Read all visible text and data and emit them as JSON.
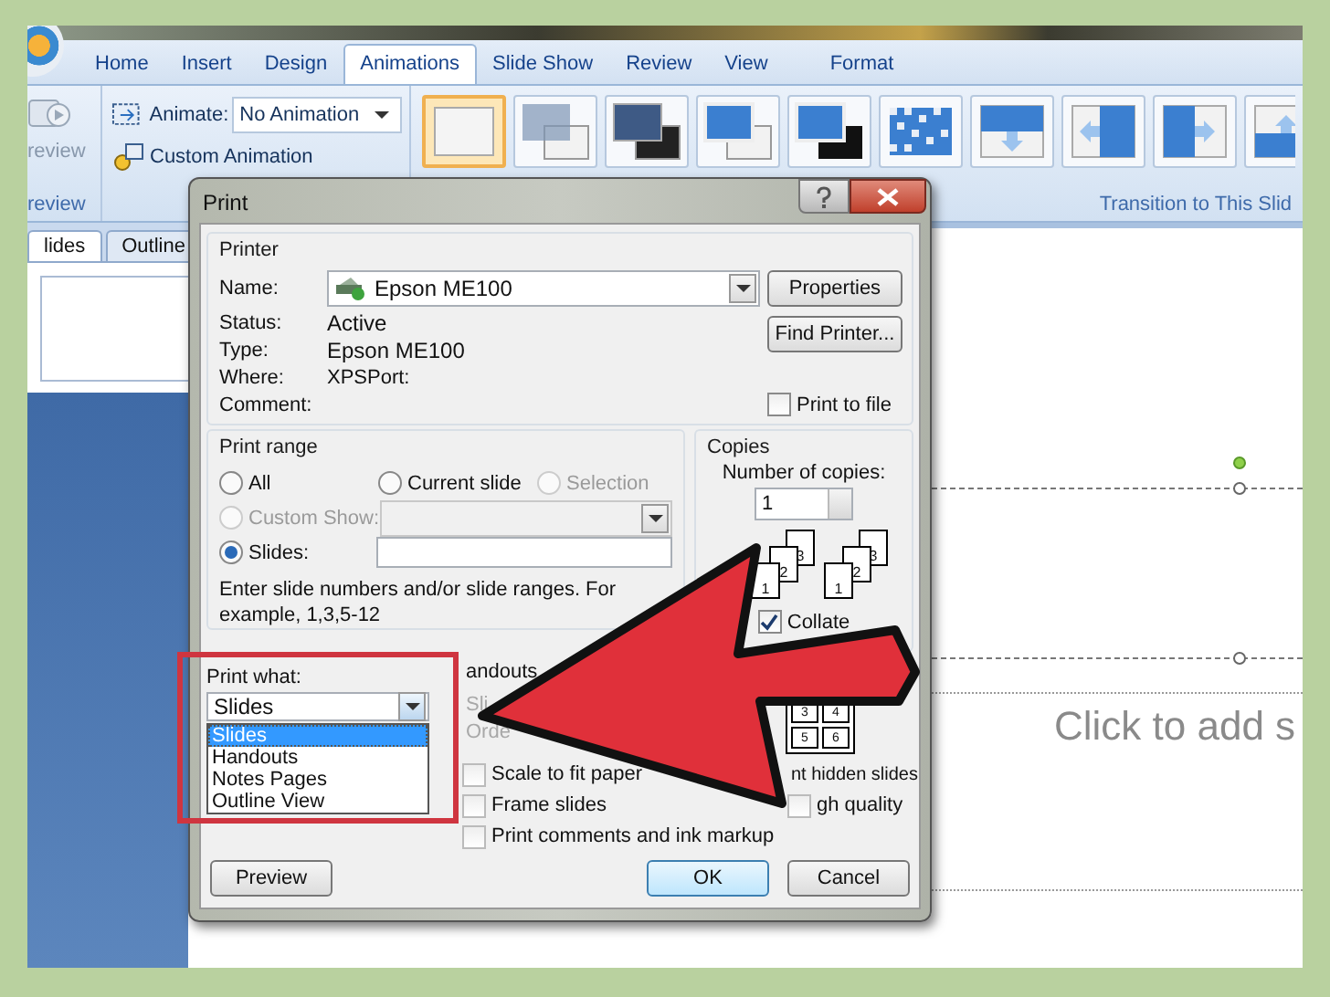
{
  "ribbon": {
    "tabs": [
      {
        "label": "Home",
        "selected": false
      },
      {
        "label": "Insert",
        "selected": false
      },
      {
        "label": "Design",
        "selected": false
      },
      {
        "label": "Animations",
        "selected": true
      },
      {
        "label": "Slide Show",
        "selected": false
      },
      {
        "label": "Review",
        "selected": false
      },
      {
        "label": "View",
        "selected": false
      },
      {
        "label": "Format",
        "selected": false
      }
    ],
    "preview_button": "review",
    "preview_group_label": "review",
    "animate_label": "Animate:",
    "animate_value": "No Animation",
    "custom_animation": "Custom Animation",
    "transitions": [
      {
        "kind": "plain",
        "selected": true
      },
      {
        "kind": "fade",
        "selected": false
      },
      {
        "kind": "fade-black",
        "selected": false
      },
      {
        "kind": "cut",
        "selected": false
      },
      {
        "kind": "cut-black",
        "selected": false
      },
      {
        "kind": "dissolve",
        "selected": false
      },
      {
        "kind": "cover-down",
        "selected": false
      },
      {
        "kind": "cover-left",
        "selected": false
      },
      {
        "kind": "cover-right",
        "selected": false
      },
      {
        "kind": "cover-up",
        "selected": false
      }
    ],
    "transition_group_label": "Transition to This Slid"
  },
  "pane_tabs": [
    {
      "label": "lides",
      "selected": true
    },
    {
      "label": "Outline",
      "selected": false
    }
  ],
  "slide": {
    "subtitle_placeholder": "Click to add s"
  },
  "dialog": {
    "title": "Print",
    "printer": {
      "heading": "Printer",
      "name_label": "Name:",
      "name": "Epson ME100",
      "status_label": "Status:",
      "status": "Active",
      "type_label": "Type:",
      "type": "Epson ME100",
      "where_label": "Where:",
      "where": "XPSPort:",
      "comment_label": "Comment:",
      "buttons": [
        "Properties",
        "Find Printer..."
      ],
      "print_to_file": {
        "label": "Print to file",
        "checked": false
      }
    },
    "print_range": {
      "heading": "Print range",
      "options": [
        {
          "label": "All",
          "selected": false,
          "disabled": false
        },
        {
          "label": "Current slide",
          "selected": false,
          "disabled": false
        },
        {
          "label": "Selection",
          "selected": false,
          "disabled": true
        },
        {
          "label": "Custom Show:",
          "selected": false,
          "disabled": true
        },
        {
          "label": "Slides:",
          "selected": true,
          "disabled": false
        }
      ],
      "hint": "Enter slide numbers and/or slide ranges. For example, 1,3,5-12"
    },
    "copies": {
      "heading": "Copies",
      "count_label": "Number of copies:",
      "count": "1",
      "page_numbers": [
        [
          "1",
          "2",
          "3"
        ],
        [
          "1",
          "2",
          "3"
        ]
      ],
      "collate": {
        "label": "Collate",
        "checked": true
      }
    },
    "print_what": {
      "label": "Print what:",
      "value": "Slides",
      "options": [
        {
          "label": "Slides",
          "selected": true
        },
        {
          "label": "Handouts",
          "selected": false
        },
        {
          "label": "Notes Pages",
          "selected": false
        },
        {
          "label": "Outline View",
          "selected": false
        }
      ]
    },
    "handouts": {
      "heading": "andouts",
      "labels": [
        "Sli",
        "Orde"
      ],
      "page_numbers": [
        "3",
        "4",
        "5",
        "6"
      ]
    },
    "options": [
      {
        "label": "Scale to fit paper",
        "checked": false
      },
      {
        "label": "Frame slides",
        "checked": false
      },
      {
        "label": "Print comments and ink markup",
        "checked": false
      },
      {
        "label": "gh quality",
        "checked": false
      }
    ],
    "hidden_slides_fragment": "nt hidden slides",
    "buttons": [
      {
        "label": "Preview",
        "default": false
      },
      {
        "label": "OK",
        "default": true
      },
      {
        "label": "Cancel",
        "default": false
      }
    ]
  }
}
